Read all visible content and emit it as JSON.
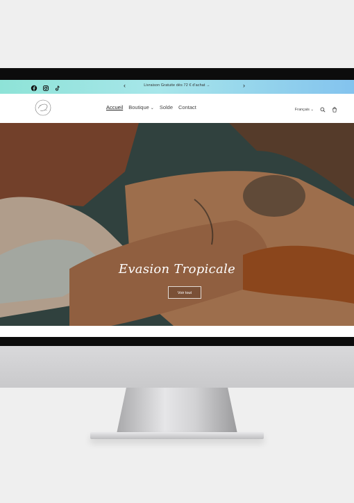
{
  "announcement": {
    "text": "Livraison Gratuite dès 72 € d'achat →",
    "prev": "‹",
    "next": "›"
  },
  "social": [
    "facebook-icon",
    "instagram-icon",
    "tiktok-icon"
  ],
  "nav": {
    "items": [
      {
        "label": "Accueil",
        "active": true
      },
      {
        "label": "Boutique",
        "dropdown": true
      },
      {
        "label": "Solde"
      },
      {
        "label": "Contact"
      }
    ]
  },
  "tools": {
    "language": "Français",
    "language_chevron": "⌄"
  },
  "hero": {
    "title": "Evasion Tropicale",
    "button": "Voir tout"
  },
  "colors": {
    "announcement_gradient_start": "#8ee3d7",
    "announcement_gradient_end": "#83c3ee"
  }
}
